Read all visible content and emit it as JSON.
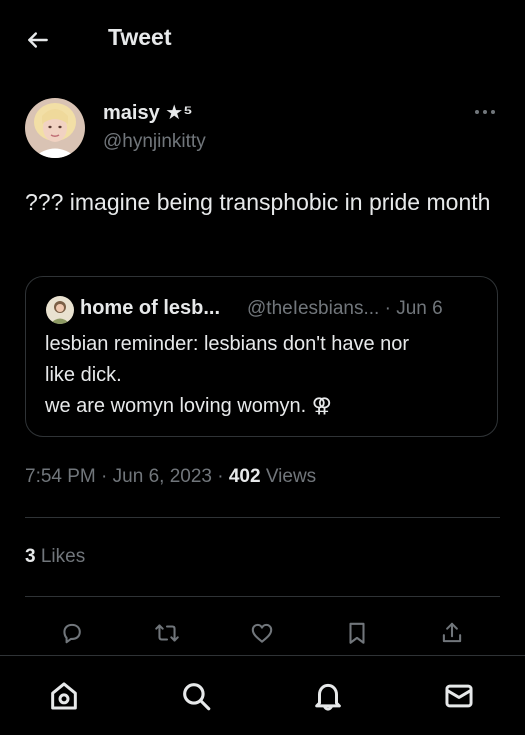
{
  "header": {
    "title": "Tweet",
    "back_icon": "arrow-left-icon"
  },
  "tweet": {
    "author_name": "maisy",
    "author_name_suffix": "★⁵",
    "author_handle": "@hynjinkitty",
    "text": "??? imagine being transphobic in pride month",
    "more_icon": "more-horizontal-icon"
  },
  "quoted": {
    "author_name": "home of lesb...",
    "author_handle": "@theIesbians...",
    "separator": "·",
    "date": "Jun 6",
    "lines": [
      "lesbian reminder: lesbians don't have nor",
      "like dick.",
      "we are womyn loving womyn. ⚢"
    ]
  },
  "meta": {
    "time": "7:54 PM",
    "separator": "·",
    "date": "Jun 6, 2023",
    "views_count": "402",
    "views_label": "Views"
  },
  "engagement": {
    "likes_count": "3",
    "likes_label": "Likes"
  },
  "actions": [
    {
      "icon": "reply-icon"
    },
    {
      "icon": "retweet-icon"
    },
    {
      "icon": "like-icon"
    },
    {
      "icon": "bookmark-icon"
    },
    {
      "icon": "share-icon"
    }
  ],
  "bottom_nav": [
    {
      "icon": "home-icon"
    },
    {
      "icon": "search-icon"
    },
    {
      "icon": "notifications-icon"
    },
    {
      "icon": "messages-icon"
    }
  ],
  "colors": {
    "background": "#000000",
    "text": "#e7e9ea",
    "secondary_text": "#71767b",
    "border": "#2f3336"
  }
}
